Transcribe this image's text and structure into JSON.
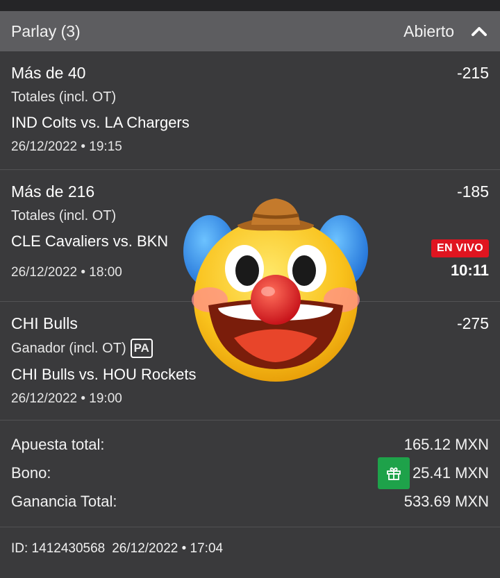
{
  "header": {
    "title": "Parlay (3)",
    "status": "Abierto"
  },
  "legs": [
    {
      "market": "Más de 40",
      "odds": "-215",
      "subtype": "Totales (incl. OT)",
      "event": "IND Colts vs. LA Chargers",
      "datetime": "26/12/2022 • 19:15"
    },
    {
      "market": "Más de 216",
      "odds": "-185",
      "subtype": "Totales (incl. OT)",
      "event": "CLE Cavaliers vs. BKN",
      "datetime": "26/12/2022 • 18:00",
      "live_label": "EN VIVO",
      "live_clock": "10:11"
    },
    {
      "market": "CHI Bulls",
      "odds": "-275",
      "subtype": "Ganador (incl. OT)",
      "badge": "PA",
      "event": "CHI Bulls vs. HOU Rockets",
      "datetime": "26/12/2022 • 19:00"
    }
  ],
  "summary": {
    "stake_label": "Apuesta total:",
    "stake_value": "165.12 MXN",
    "bonus_label": "Bono:",
    "bonus_value": "25.41 MXN",
    "winnings_label": "Ganancia Total:",
    "winnings_value": "533.69 MXN"
  },
  "footer": {
    "id_text": "ID: 1412430568",
    "placed_at": "26/12/2022 • 17:04"
  },
  "colors": {
    "background": "#3a3a3c",
    "header": "#5d5d60",
    "live": "#e01520",
    "gift": "#1ea24a"
  },
  "icons": [
    "chevron-up-icon",
    "gift-icon",
    "clown-face-emoji"
  ]
}
